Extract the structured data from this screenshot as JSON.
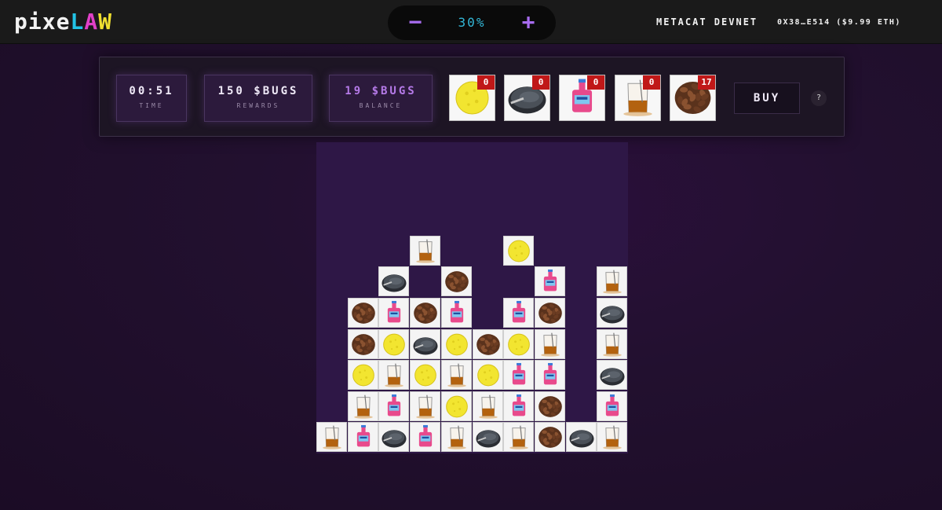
{
  "header": {
    "logo": {
      "p1": "pixe",
      "l1": "L",
      "l2": "A",
      "l3": "W"
    },
    "zoom": {
      "minus": "−",
      "value": "30%",
      "plus": "+"
    },
    "network": "METACAT DEVNET",
    "wallet": "0X38…E514 ($9.99 ETH)"
  },
  "hud": {
    "time": {
      "value": "00:51",
      "label": "TIME"
    },
    "rewards": {
      "value": "150 $BUGS",
      "label": "REWARDS"
    },
    "balance": {
      "value": "19 $BUGS",
      "label": "BALANCE"
    },
    "items": [
      {
        "icon": "sponge-icon",
        "count": "0"
      },
      {
        "icon": "pan-icon",
        "count": "0"
      },
      {
        "icon": "cleaner-bottle-icon",
        "count": "0"
      },
      {
        "icon": "beaker-icon",
        "count": "0"
      },
      {
        "icon": "soil-icon",
        "count": "17"
      }
    ],
    "buy_label": "BUY",
    "help_label": "?"
  },
  "board": {
    "columns": 10,
    "rows": 10,
    "grid": [
      [
        "",
        "",
        "",
        "",
        "",
        "",
        "",
        "",
        "",
        ""
      ],
      [
        "",
        "",
        "",
        "",
        "",
        "",
        "",
        "",
        "",
        ""
      ],
      [
        "",
        "",
        "",
        "",
        "",
        "",
        "",
        "",
        "",
        ""
      ],
      [
        "",
        "",
        "",
        "beaker",
        "",
        "",
        "sponge",
        "",
        "",
        ""
      ],
      [
        "",
        "",
        "pan",
        "",
        "soil",
        "",
        "",
        "bottle",
        "",
        "beaker"
      ],
      [
        "",
        "soil",
        "bottle",
        "soil",
        "bottle",
        "",
        "bottle",
        "soil",
        "",
        "pan"
      ],
      [
        "",
        "soil",
        "sponge",
        "pan",
        "sponge",
        "soil",
        "sponge",
        "beaker",
        "",
        "beaker"
      ],
      [
        "",
        "sponge",
        "beaker",
        "sponge",
        "beaker",
        "sponge",
        "bottle",
        "bottle",
        "",
        "pan"
      ],
      [
        "",
        "beaker",
        "bottle",
        "beaker",
        "sponge",
        "beaker",
        "bottle",
        "soil",
        "",
        "bottle"
      ],
      [
        "beaker",
        "bottle",
        "pan",
        "bottle",
        "beaker",
        "pan",
        "beaker",
        "soil",
        "pan",
        "beaker"
      ]
    ]
  }
}
